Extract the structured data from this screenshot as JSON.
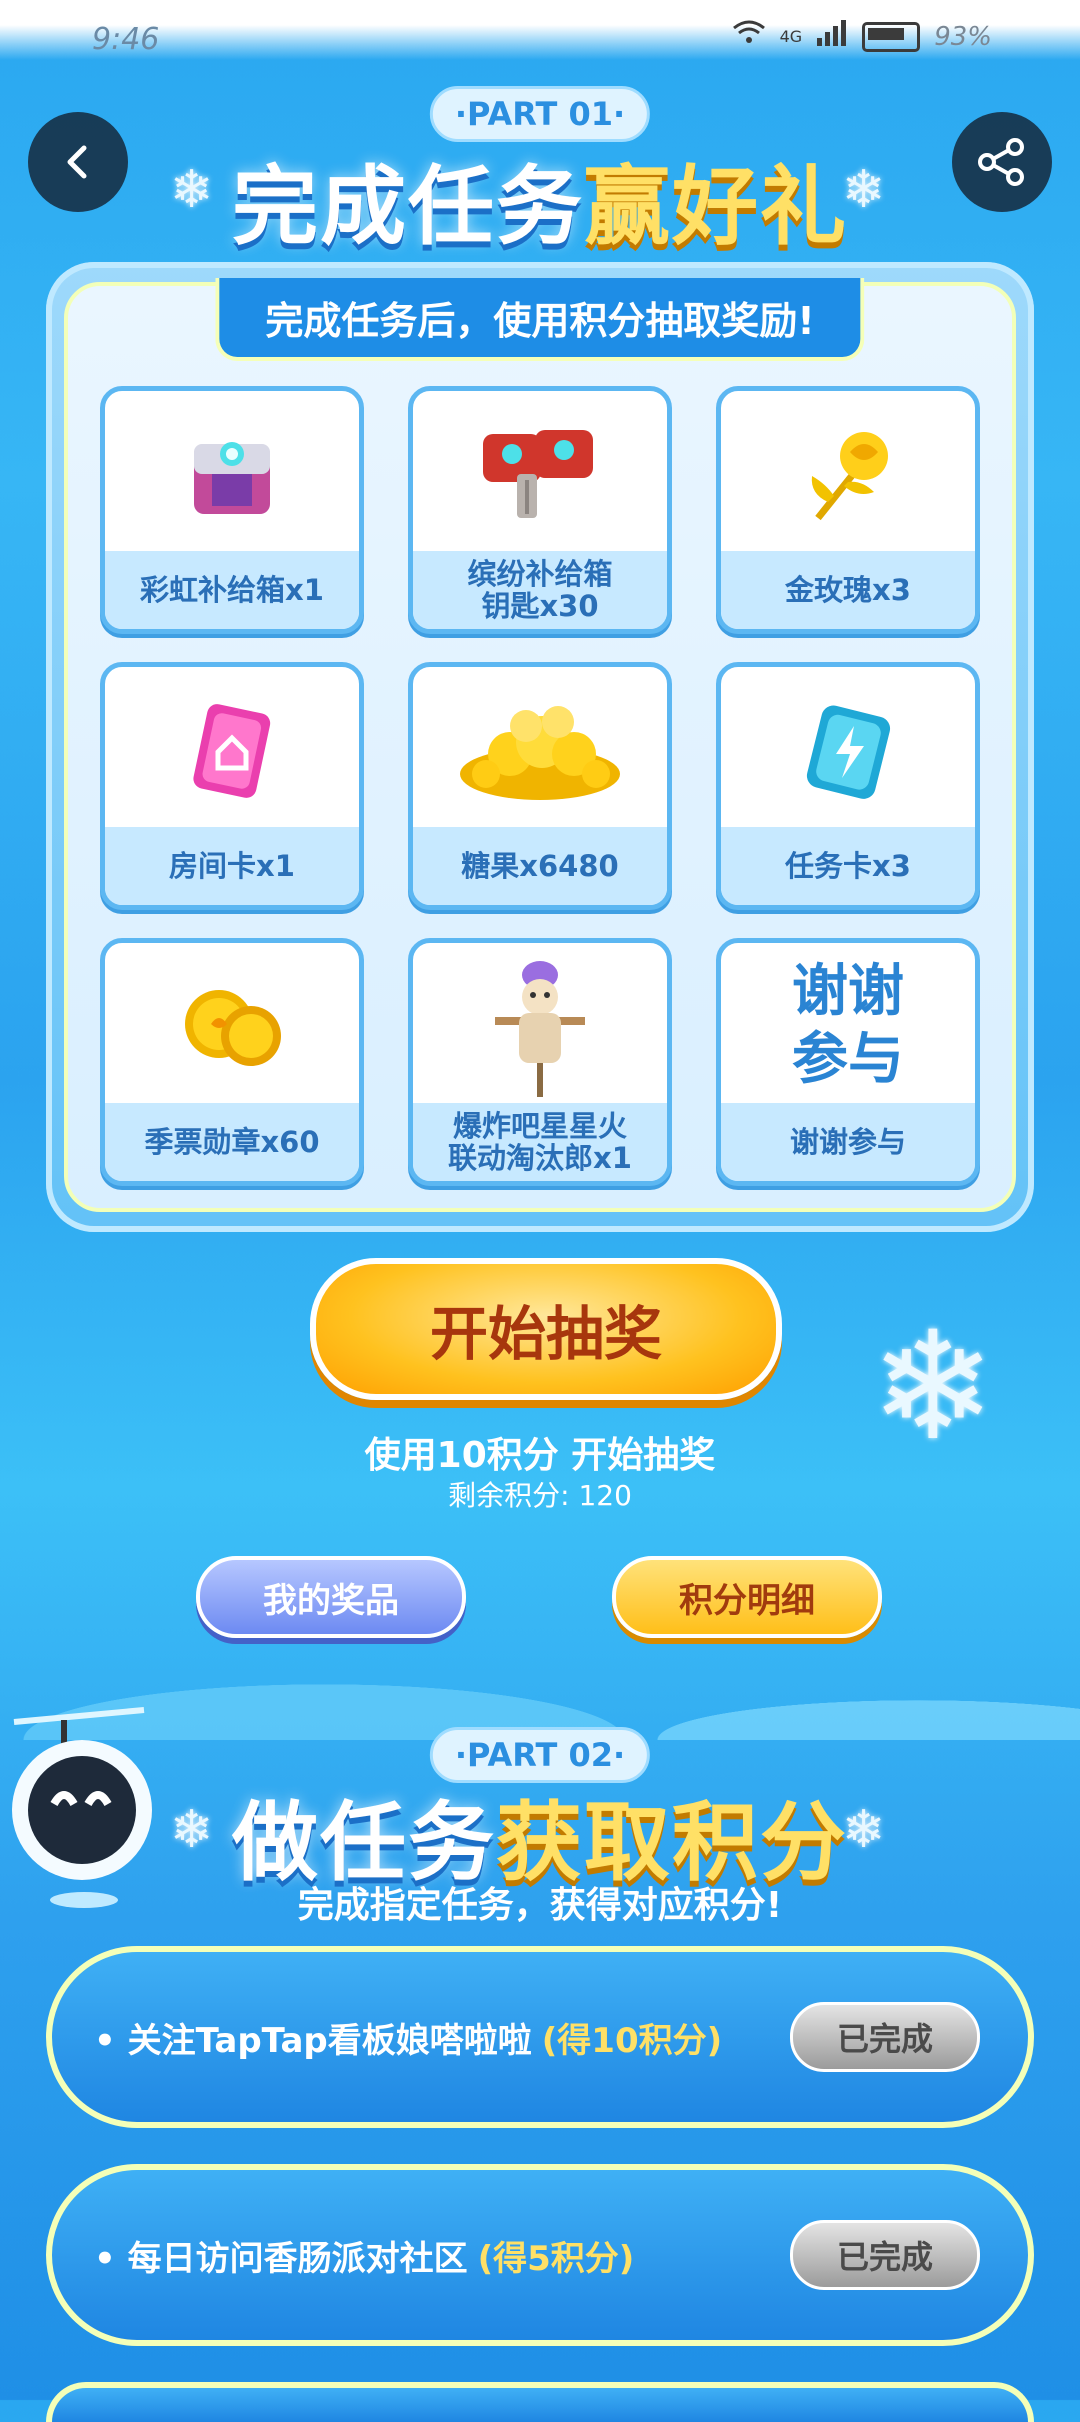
{
  "status": {
    "time": "9:46",
    "battery": "93%",
    "signal": "4G"
  },
  "part1": {
    "pill": "·PART 01·",
    "title_main": "完成任务",
    "title_hl": "赢好礼",
    "banner": "完成任务后，使用积分抽取奖励!",
    "prizes": [
      {
        "label": "彩虹补给箱x1",
        "icon": "rainbow-supply-box"
      },
      {
        "label": "缤纷补给箱\n钥匙x30",
        "icon": "supply-box-key"
      },
      {
        "label": "金玫瑰x3",
        "icon": "golden-rose"
      },
      {
        "label": "房间卡x1",
        "icon": "room-card"
      },
      {
        "label": "糖果x6480",
        "icon": "candy-pile"
      },
      {
        "label": "任务卡x3",
        "icon": "task-card"
      },
      {
        "label": "季票勋章x60",
        "icon": "season-medal"
      },
      {
        "label": "爆炸吧星星火\n联动淘汰郎x1",
        "icon": "scarecrow-figure"
      },
      {
        "label": "谢谢参与",
        "icon": "thanks-text",
        "art_text": "谢谢\n参与"
      }
    ],
    "draw_button": "开始抽奖",
    "use_text": "使用10积分 开始抽奖",
    "remaining": "剩余积分: 120",
    "my_prizes": "我的奖品",
    "points_detail": "积分明细"
  },
  "part2": {
    "pill": "·PART 02·",
    "title_main": "做任务",
    "title_hl": "获取积分",
    "subtitle": "完成指定任务，获得对应积分!",
    "tasks": [
      {
        "text": "• 关注TapTap看板娘嗒啦啦",
        "points": "(得10积分)",
        "status": "已完成"
      },
      {
        "text": "• 每日访问香肠派对社区",
        "points": "(得5积分)",
        "status": "已完成"
      }
    ]
  },
  "colors": {
    "accent_yellow": "#ffe066",
    "panel_blue": "#1e8de6",
    "label_blue": "#2a6fb7"
  }
}
